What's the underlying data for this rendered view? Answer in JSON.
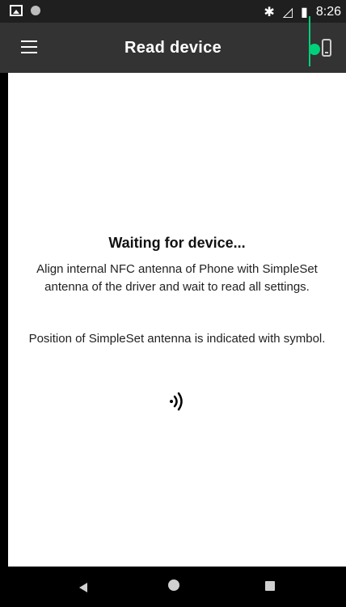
{
  "status": {
    "time": "8:26",
    "icons": [
      "image-icon",
      "dot-icon",
      "bluetooth-icon",
      "signal-icon",
      "battery-icon"
    ]
  },
  "appbar": {
    "title": "Read device",
    "menu_icon": "hamburger-icon",
    "device_icon": "phone-icon",
    "accent": "#00d07a"
  },
  "main": {
    "heading": "Waiting for device...",
    "instruction": "Align internal NFC antenna of Phone with SimpleSet antenna of the driver and wait to read all settings.",
    "position_note": "Position of SimpleSet antenna is indicated with symbol.",
    "symbol_icon": "nfc-icon"
  },
  "nav": {
    "icons": [
      "back-icon",
      "home-icon",
      "recent-apps-icon"
    ]
  }
}
